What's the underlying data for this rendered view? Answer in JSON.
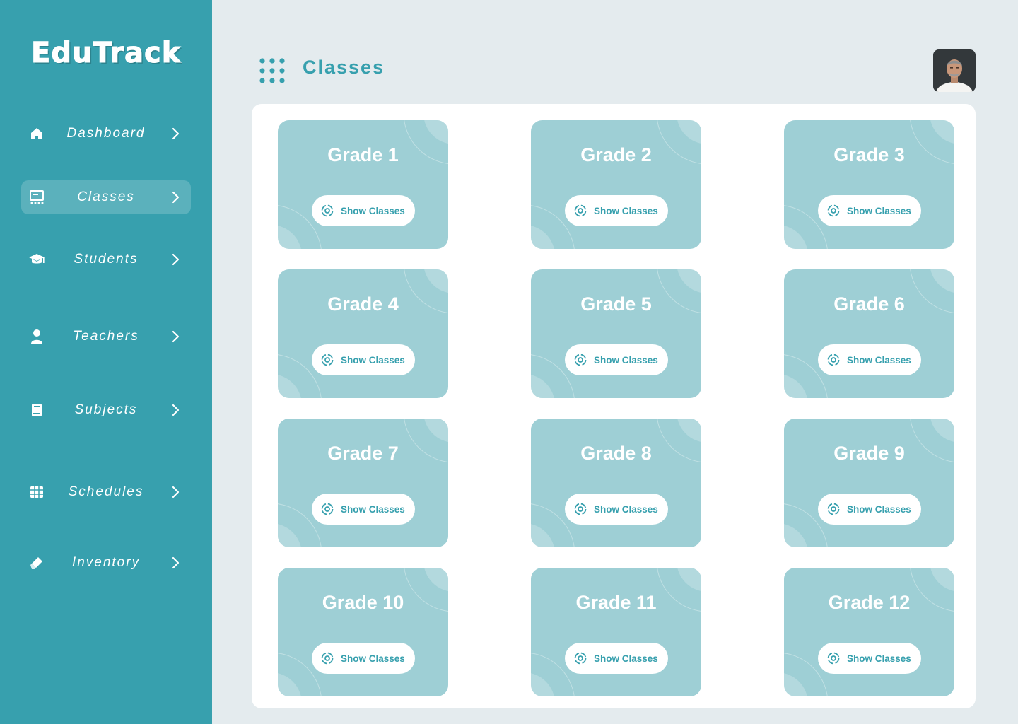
{
  "app": {
    "logo": "EduTrack"
  },
  "sidebar": {
    "items": [
      {
        "label": "Dashboard",
        "icon": "home-icon"
      },
      {
        "label": "Classes",
        "icon": "classroom-icon",
        "active": true
      },
      {
        "label": "Students",
        "icon": "graduation-cap-icon"
      },
      {
        "label": "Teachers",
        "icon": "person-icon"
      },
      {
        "label": "Subjects",
        "icon": "book-icon"
      },
      {
        "label": "Schedules",
        "icon": "calendar-grid-icon"
      },
      {
        "label": "Inventory",
        "icon": "eraser-icon"
      }
    ]
  },
  "header": {
    "title": "Classes",
    "menu_icon": "dots-grid-icon",
    "avatar": "user-avatar"
  },
  "grades": [
    {
      "title": "Grade 1",
      "button": "Show Classes"
    },
    {
      "title": "Grade 2",
      "button": "Show Classes"
    },
    {
      "title": "Grade 3",
      "button": "Show Classes"
    },
    {
      "title": "Grade 4",
      "button": "Show Classes"
    },
    {
      "title": "Grade 5",
      "button": "Show Classes"
    },
    {
      "title": "Grade 6",
      "button": "Show Classes"
    },
    {
      "title": "Grade 7",
      "button": "Show Classes"
    },
    {
      "title": "Grade 8",
      "button": "Show Classes"
    },
    {
      "title": "Grade 9",
      "button": "Show Classes"
    },
    {
      "title": "Grade 10",
      "button": "Show Classes"
    },
    {
      "title": "Grade 11",
      "button": "Show Classes"
    },
    {
      "title": "Grade 12",
      "button": "Show Classes"
    }
  ],
  "colors": {
    "sidebar": "#37a0ae",
    "accent": "#37a0ae",
    "card": "#9ecfd5",
    "background": "#e4ebee"
  }
}
